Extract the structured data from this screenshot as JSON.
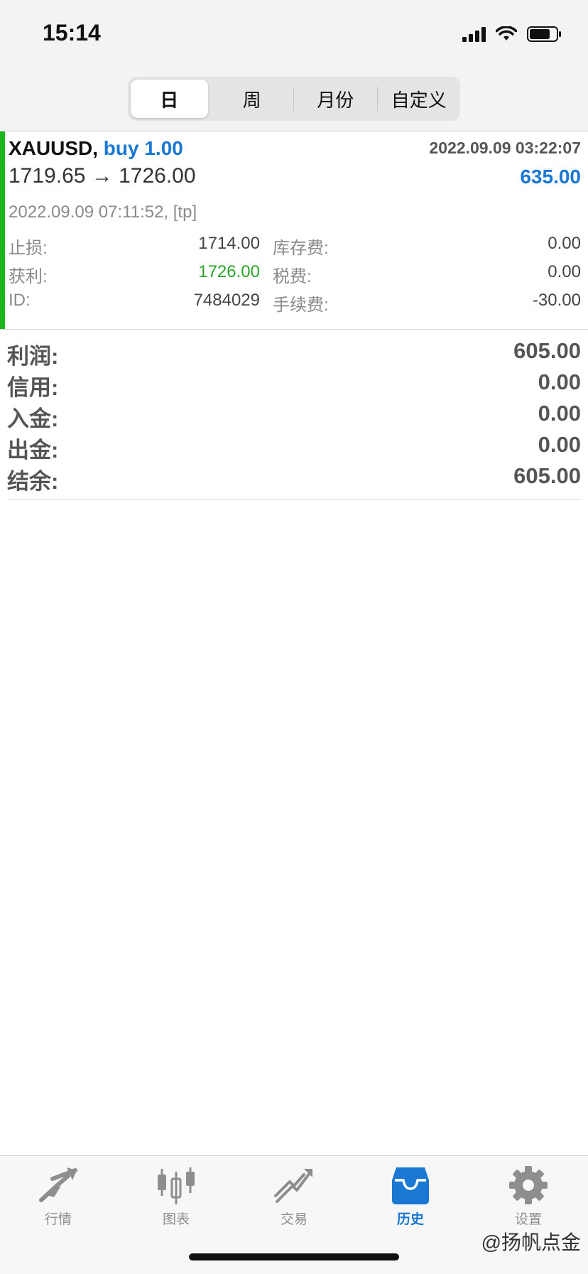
{
  "status_bar": {
    "time": "15:14"
  },
  "segments": [
    "日",
    "周",
    "月份",
    "自定义"
  ],
  "trade": {
    "symbol": "XAUUSD,",
    "side": "buy 1.00",
    "open_time": "2022.09.09 03:22:07",
    "prices": "1719.65 → 1726.00",
    "profit": "635.00",
    "close_info": "2022.09.09 07:11:52, [tp]",
    "sl_label": "止损:",
    "sl_value": "1714.00",
    "tp_label": "获利:",
    "tp_value": "1726.00",
    "id_label": "ID:",
    "id_value": "7484029",
    "swap_label": "库存费:",
    "swap_value": "0.00",
    "tax_label": "税费:",
    "tax_value": "0.00",
    "commission_label": "手续费:",
    "commission_value": "-30.00"
  },
  "summary": [
    {
      "label": "利润:",
      "value": "605.00"
    },
    {
      "label": "信用:",
      "value": "0.00"
    },
    {
      "label": "入金:",
      "value": "0.00"
    },
    {
      "label": "出金:",
      "value": "0.00"
    },
    {
      "label": "结余:",
      "value": "605.00"
    }
  ],
  "tabbar": [
    {
      "label": "行情",
      "icon": "quotes-icon"
    },
    {
      "label": "图表",
      "icon": "chart-icon"
    },
    {
      "label": "交易",
      "icon": "trade-icon"
    },
    {
      "label": "历史",
      "icon": "history-icon",
      "active": true
    },
    {
      "label": "设置",
      "icon": "settings-icon"
    }
  ],
  "watermark": "@扬帆点金",
  "colors": {
    "accent": "#1a78d2",
    "profit_bar": "#1db51d",
    "tp_green": "#2aa52a"
  }
}
